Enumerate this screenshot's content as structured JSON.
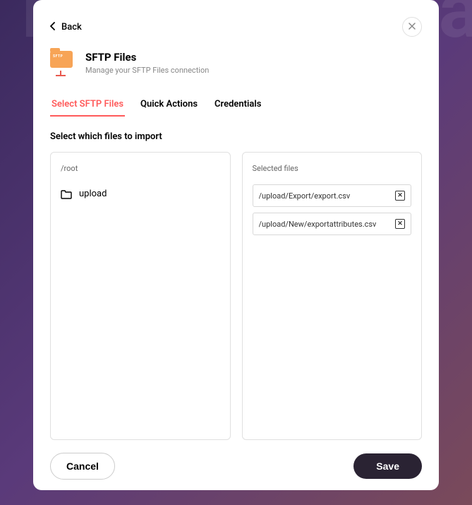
{
  "bgText": "Demo application",
  "back": "Back",
  "title": "SFTP Files",
  "subtitle": "Manage your SFTP Files connection",
  "iconBadge": "SFTP",
  "tabs": [
    {
      "label": "Select SFTP Files",
      "active": true
    },
    {
      "label": "Quick Actions",
      "active": false
    },
    {
      "label": "Credentials",
      "active": false
    }
  ],
  "instruction": "Select which files to import",
  "browser": {
    "currentPath": "/root",
    "items": [
      {
        "name": "upload",
        "type": "folder"
      }
    ]
  },
  "selected": {
    "label": "Selected files",
    "files": [
      "/upload/Export/export.csv",
      "/upload/New/exportattributes.csv"
    ]
  },
  "buttons": {
    "cancel": "Cancel",
    "save": "Save"
  }
}
